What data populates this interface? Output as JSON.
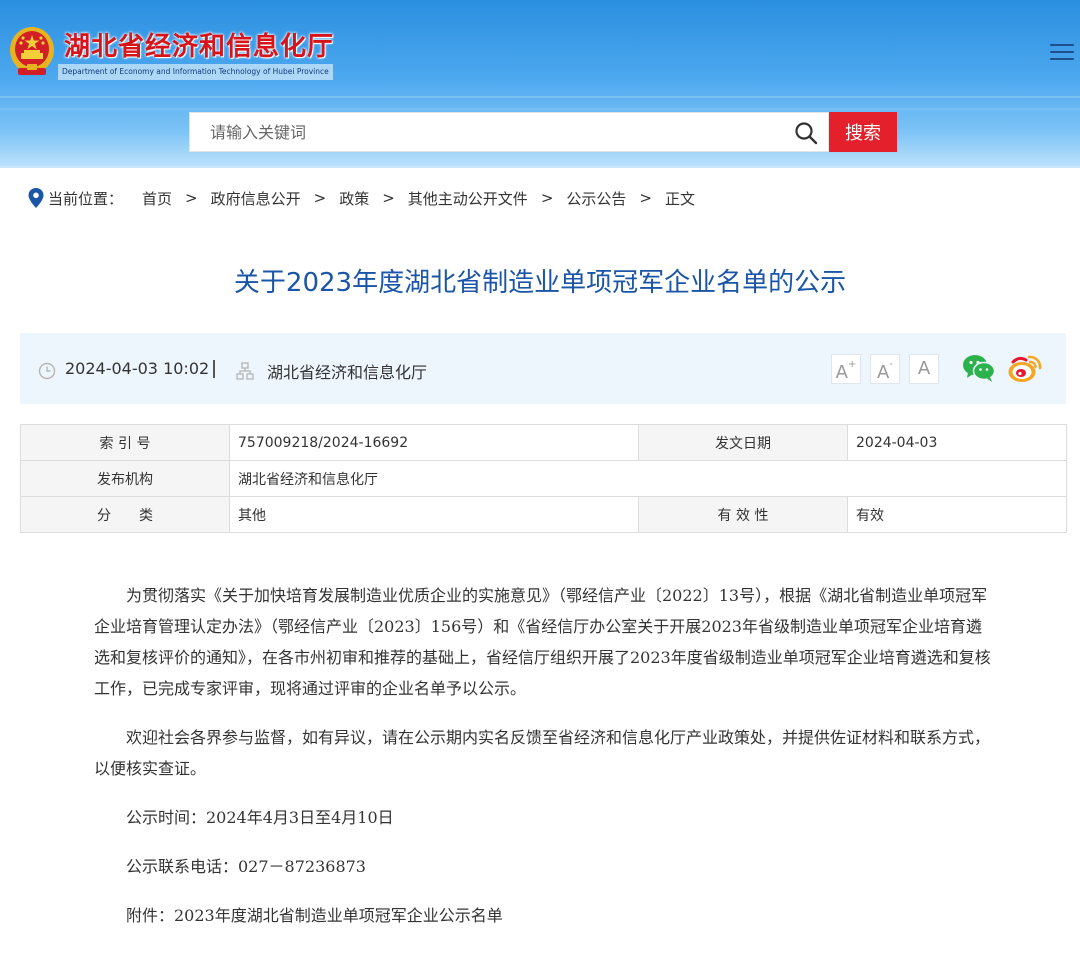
{
  "header": {
    "title": "湖北省经济和信息化厅",
    "subtitle": "Department of Economy and Information Technology of Hubei Province"
  },
  "search": {
    "placeholder": "请输入关键词",
    "button_label": "搜索"
  },
  "breadcrumb": {
    "label": "当前位置：",
    "items": [
      "首页",
      "政府信息公开",
      "政策",
      "其他主动公开文件",
      "公示公告",
      "正文"
    ],
    "separator": ">"
  },
  "article": {
    "title": "关于2023年度湖北省制造业单项冠军企业名单的公示",
    "datetime": "2024-04-03 10:02",
    "divider": "|",
    "source": "湖北省经济和信息化厅",
    "font_sizes": [
      "A",
      "A",
      "A"
    ]
  },
  "info_table": {
    "index_label": "索 引 号",
    "index_value": "757009218/2024-16692",
    "date_label": "发文日期",
    "date_value": "2024-04-03",
    "org_label": "发布机构",
    "org_value": "湖北省经济和信息化厅",
    "category_label": "分　　类",
    "category_value": "其他",
    "validity_label": "有 效 性",
    "validity_value": "有效"
  },
  "body": {
    "p1": "为贯彻落实《关于加快培育发展制造业优质企业的实施意见》（鄂经信产业〔2022〕13号），根据《湖北省制造业单项冠军企业培育管理认定办法》（鄂经信产业〔2023〕156号）和《省经信厅办公室关于开展2023年省级制造业单项冠军企业培育遴选和复核评价的通知》，在各市州初审和推荐的基础上，省经信厅组织开展了2023年度省级制造业单项冠军企业培育遴选和复核工作，已完成专家评审，现将通过评审的企业名单予以公示。",
    "p2": "欢迎社会各界参与监督，如有异议，请在公示期内实名反馈至省经济和信息化厅产业政策处，并提供佐证材料和联系方式，以便核实查证。",
    "p3": "公示时间：2024年4月3日至4月10日",
    "p4": "公示联系电话：027－87236873",
    "p5": "附件：2023年度湖北省制造业单项冠军企业公示名单"
  },
  "colors": {
    "header_top": "#2b8fe0",
    "title_red": "#d6141b",
    "search_button": "#e3202b",
    "article_title_blue": "#1a55a8",
    "meta_bar_bg": "#edf5fd"
  }
}
